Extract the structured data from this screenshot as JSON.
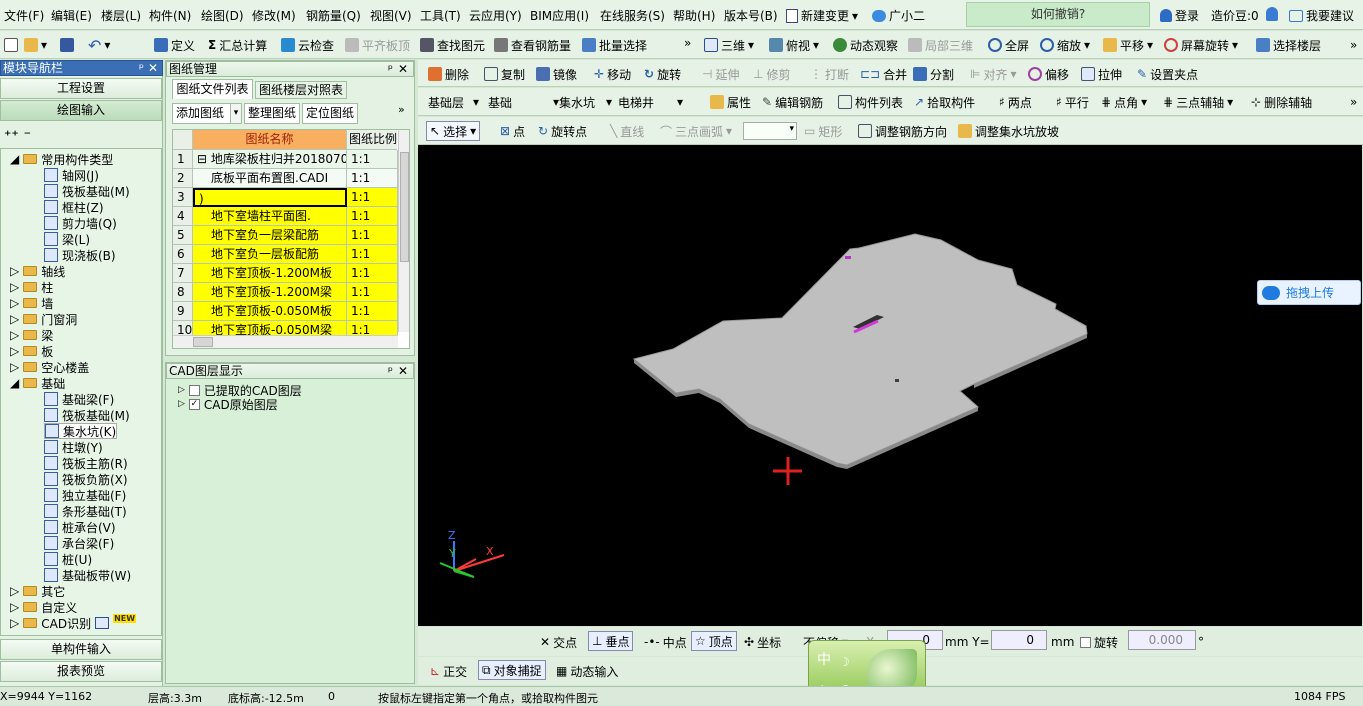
{
  "menu": [
    "文件(F)",
    "编辑(E)",
    "楼层(L)",
    "构件(N)",
    "绘图(D)",
    "修改(M)",
    "钢筋量(Q)",
    "视图(V)",
    "工具(T)",
    "云应用(Y)",
    "BIM应用(I)",
    "在线服务(S)",
    "帮助(H)",
    "版本号(B)",
    "新建变更",
    "广小二"
  ],
  "ask_box": "如何撤销?",
  "user": {
    "login": "登录",
    "beans": "造价豆:0",
    "suggest": "我要建议"
  },
  "toolbar1": {
    "define": "定义",
    "sum": "汇总计算",
    "cloud_check": "云检查",
    "flat_top": "平齐板顶",
    "find": "查找图元",
    "view_rebar": "查看钢筋量",
    "batch_select": "批量选择",
    "three_d": "三维",
    "top_view": "俯视",
    "dynamic_view": "动态观察",
    "local_3d": "局部三维",
    "fullscreen": "全屏",
    "zoom": "缩放",
    "pan": "平移",
    "rotate_screen": "屏幕旋转",
    "select_floor": "选择楼层"
  },
  "toolbar2": {
    "delete": "删除",
    "copy": "复制",
    "mirror": "镜像",
    "move": "移动",
    "rotate": "旋转",
    "extend": "延伸",
    "trim": "修剪",
    "break": "打断",
    "merge": "合并",
    "split": "分割",
    "align": "对齐",
    "offset": "偏移",
    "stretch": "拉伸",
    "set_clip": "设置夹点"
  },
  "toolbar3": {
    "floor": "基础层",
    "category": "基础",
    "type": "集水坑",
    "element": "电梯井",
    "property": "属性",
    "edit_rebar": "编辑钢筋",
    "element_list": "构件列表",
    "pick": "拾取构件",
    "two_points": "两点",
    "parallel": "平行",
    "corner": "点角",
    "three_aux": "三点辅轴",
    "del_aux": "删除辅轴"
  },
  "toolbar4": {
    "select": "选择",
    "point": "点",
    "rotate_point": "旋转点",
    "line": "直线",
    "arc": "三点画弧",
    "rect": "矩形",
    "adjust_rebar": "调整钢筋方向",
    "adjust_pit": "调整集水坑放坡"
  },
  "nav": {
    "title": "模块导航栏",
    "engineering": "工程设置",
    "drawing_input": "绘图输入",
    "single_input": "单构件输入",
    "report": "报表预览"
  },
  "tree": {
    "common": "常用构件类型",
    "common_items": [
      "轴网(J)",
      "筏板基础(M)",
      "框柱(Z)",
      "剪力墙(Q)",
      "梁(L)",
      "现浇板(B)"
    ],
    "groups": [
      "轴线",
      "柱",
      "墙",
      "门窗洞",
      "梁",
      "板",
      "空心楼盖",
      "基础"
    ],
    "foundation_items": [
      "基础梁(F)",
      "筏板基础(M)",
      "集水坑(K)",
      "柱墩(Y)",
      "筏板主筋(R)",
      "筏板负筋(X)",
      "独立基础(F)",
      "条形基础(T)",
      "桩承台(V)",
      "承台梁(F)",
      "桩(U)",
      "基础板带(W)"
    ],
    "others": [
      "其它",
      "自定义",
      "CAD识别"
    ],
    "new_badge": "NEW"
  },
  "drawings": {
    "title": "图纸管理",
    "tabs": [
      "图纸文件列表",
      "图纸楼层对照表"
    ],
    "buttons": [
      "添加图纸",
      "整理图纸",
      "定位图纸"
    ],
    "col_name": "图纸名称",
    "col_scale": "图纸比例",
    "rows": [
      {
        "n": "1",
        "name": "地库梁板柱归并2018070",
        "scale": "1:1"
      },
      {
        "n": "2",
        "name": "底板平面布置图.CADI",
        "scale": "1:1"
      },
      {
        "n": "3",
        "name": ")",
        "scale": "1:1"
      },
      {
        "n": "4",
        "name": "地下室墙柱平面图.",
        "scale": "1:1"
      },
      {
        "n": "5",
        "name": "地下室负一层梁配筋",
        "scale": "1:1"
      },
      {
        "n": "6",
        "name": "地下室负一层板配筋",
        "scale": "1:1"
      },
      {
        "n": "7",
        "name": "地下室顶板-1.200M板",
        "scale": "1:1"
      },
      {
        "n": "8",
        "name": "地下室顶板-1.200M梁",
        "scale": "1:1"
      },
      {
        "n": "9",
        "name": "地下室顶板-0.050M板",
        "scale": "1:1"
      },
      {
        "n": "10",
        "name": "地下室顶板-0.050M梁",
        "scale": "1:1"
      }
    ]
  },
  "cad_layers": {
    "title": "CAD图层显示",
    "items": [
      "已提取的CAD图层",
      "CAD原始图层"
    ]
  },
  "upload": "拖拽上传",
  "snap": {
    "intersection": "交点",
    "perpendicular": "垂点",
    "midpoint": "中点",
    "vertex": "顶点",
    "coord": "坐标",
    "no_offset": "不偏移",
    "x_label": "X=",
    "x_val": "0",
    "mm1": "mm Y=",
    "y_val": "0",
    "mm2": "mm",
    "rotate": "旋转",
    "rot_val": "0.000",
    "deg": "°"
  },
  "bottom": {
    "ortho": "正交",
    "snap": "对象捕捉",
    "dyn_input": "动态输入",
    "ime": "中"
  },
  "status": {
    "coords": "X=9944 Y=1162",
    "floor_h": "层高:3.3m",
    "bottom_h": "底标高:-12.5m",
    "zero": "0",
    "hint": "按鼠标左键指定第一个角点，或拾取构件图元",
    "fps": "1084 FPS"
  },
  "colors": {
    "bg": "#d4e8d4",
    "viewport": "#000000",
    "slab": "#bfbfbf",
    "selected_row": "#ffff00",
    "accent": "#1f7be0"
  }
}
